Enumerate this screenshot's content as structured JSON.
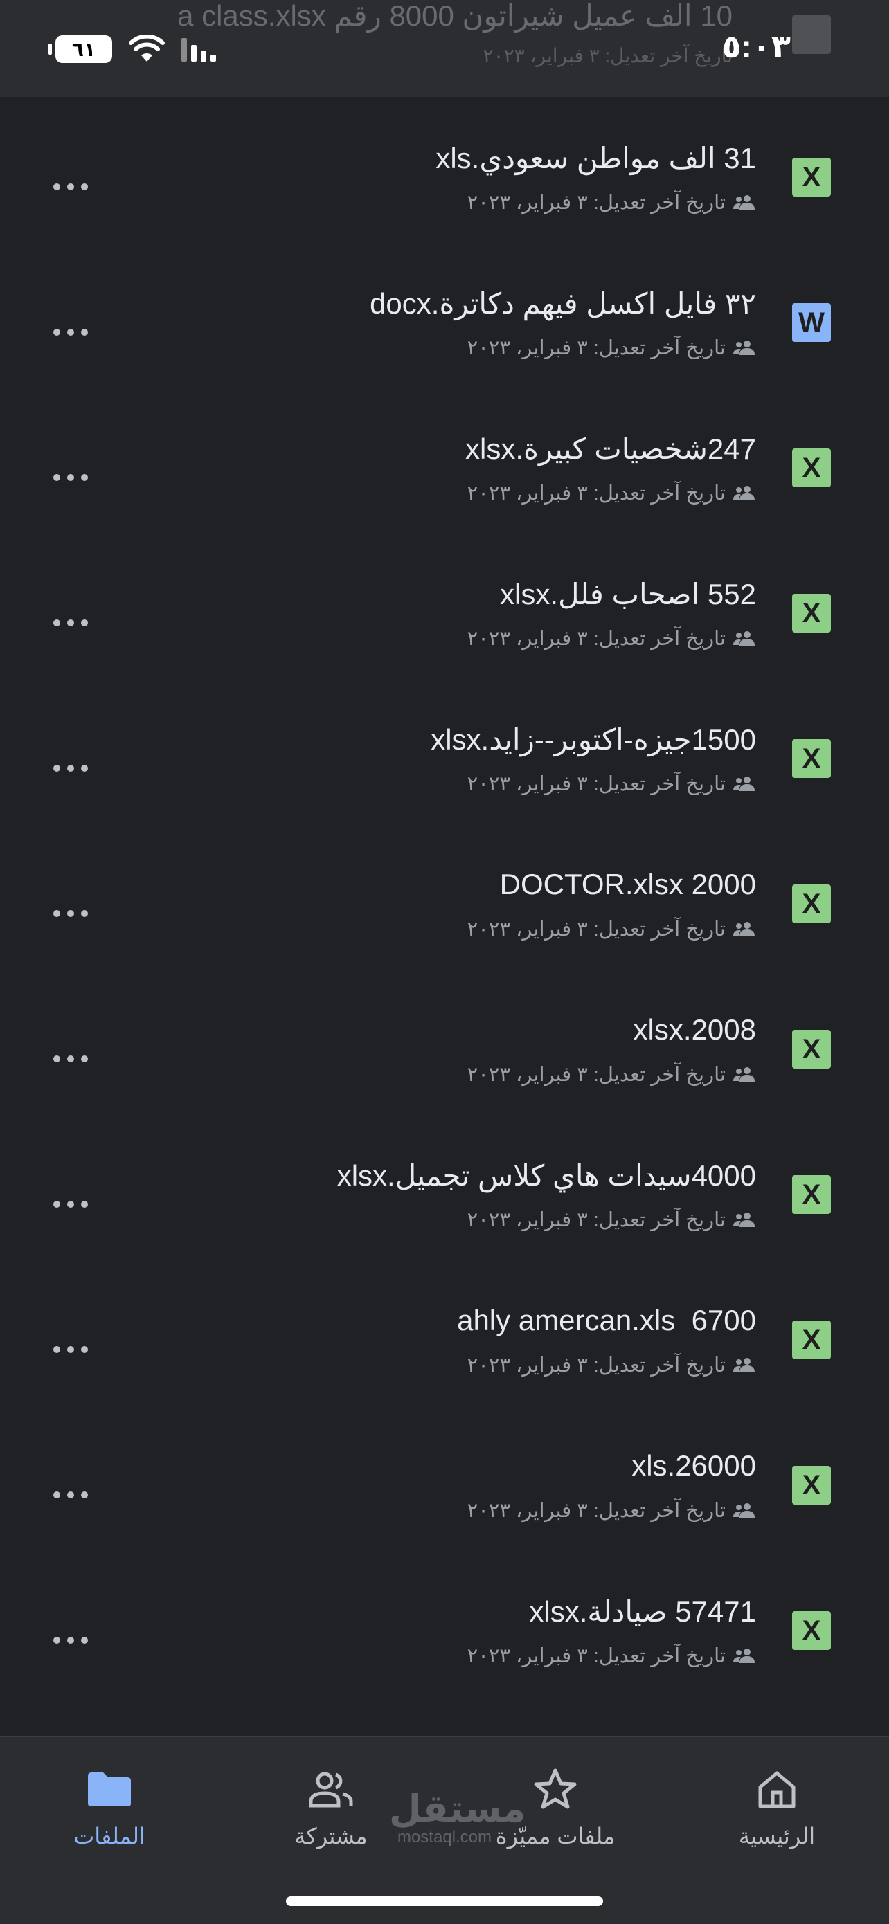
{
  "status_bar": {
    "time": "٥:٠٣",
    "battery": "٦١"
  },
  "ghost_row": {
    "title": "10 الف عميل شيراتون 8000 رقم a class.xlsx",
    "subtitle": "تاريخ آخر تعديل: ٣ فبراير، ٢٠٢٣"
  },
  "files": [
    {
      "title": "31 الف مواطن سعودي.xls",
      "subtitle": "تاريخ آخر تعديل: ٣ فبراير، ٢٠٢٣",
      "icon": "excel-icon",
      "icon_letter": "X"
    },
    {
      "title": "٣٢ فايل اكسل فيهم دكاترة.docx",
      "subtitle": "تاريخ آخر تعديل: ٣ فبراير، ٢٠٢٣",
      "icon": "word-icon",
      "icon_letter": "W"
    },
    {
      "title": "247شخصيات كبيرة.xlsx",
      "subtitle": "تاريخ آخر تعديل: ٣ فبراير، ٢٠٢٣",
      "icon": "excel-icon",
      "icon_letter": "X"
    },
    {
      "title": "552 اصحاب فلل.xlsx",
      "subtitle": "تاريخ آخر تعديل: ٣ فبراير، ٢٠٢٣",
      "icon": "excel-icon",
      "icon_letter": "X"
    },
    {
      "title": "1500جيزه-اكتوبر--زايد.xlsx",
      "subtitle": "تاريخ آخر تعديل: ٣ فبراير، ٢٠٢٣",
      "icon": "excel-icon",
      "icon_letter": "X"
    },
    {
      "title": "2000 DOCTOR.xlsx",
      "subtitle": "تاريخ آخر تعديل: ٣ فبراير، ٢٠٢٣",
      "icon": "excel-icon",
      "icon_letter": "X"
    },
    {
      "title": "2008.xlsx",
      "subtitle": "تاريخ آخر تعديل: ٣ فبراير، ٢٠٢٣",
      "icon": "excel-icon",
      "icon_letter": "X"
    },
    {
      "title": "4000سيدات هاي كلاس تجميل.xlsx",
      "subtitle": "تاريخ آخر تعديل: ٣ فبراير، ٢٠٢٣",
      "icon": "excel-icon",
      "icon_letter": "X"
    },
    {
      "title": "6700  ahly amercan.xls",
      "subtitle": "تاريخ آخر تعديل: ٣ فبراير، ٢٠٢٣",
      "icon": "excel-icon",
      "icon_letter": "X"
    },
    {
      "title": "26000.xls",
      "subtitle": "تاريخ آخر تعديل: ٣ فبراير، ٢٠٢٣",
      "icon": "excel-icon",
      "icon_letter": "X"
    },
    {
      "title": "57471 صيادلة.xlsx",
      "subtitle": "تاريخ آخر تعديل: ٣ فبراير، ٢٠٢٣",
      "icon": "excel-icon",
      "icon_letter": "X"
    }
  ],
  "bottom_nav": {
    "items": [
      {
        "label": "الملفات",
        "icon": "folder-icon",
        "active": true
      },
      {
        "label": "مشتركة",
        "icon": "people-icon",
        "active": false
      },
      {
        "label": "ملفات مميّزة",
        "icon": "star-icon",
        "active": false
      },
      {
        "label": "الرئيسية",
        "icon": "home-icon",
        "active": false
      }
    ]
  },
  "watermark": {
    "arabic": "مستقل",
    "latin": "mostaql.com"
  },
  "colors": {
    "background": "#202124",
    "bar": "#2c2d30",
    "excel": "#8ecf87",
    "word": "#8ab4f8",
    "active": "#8ab4f8"
  }
}
